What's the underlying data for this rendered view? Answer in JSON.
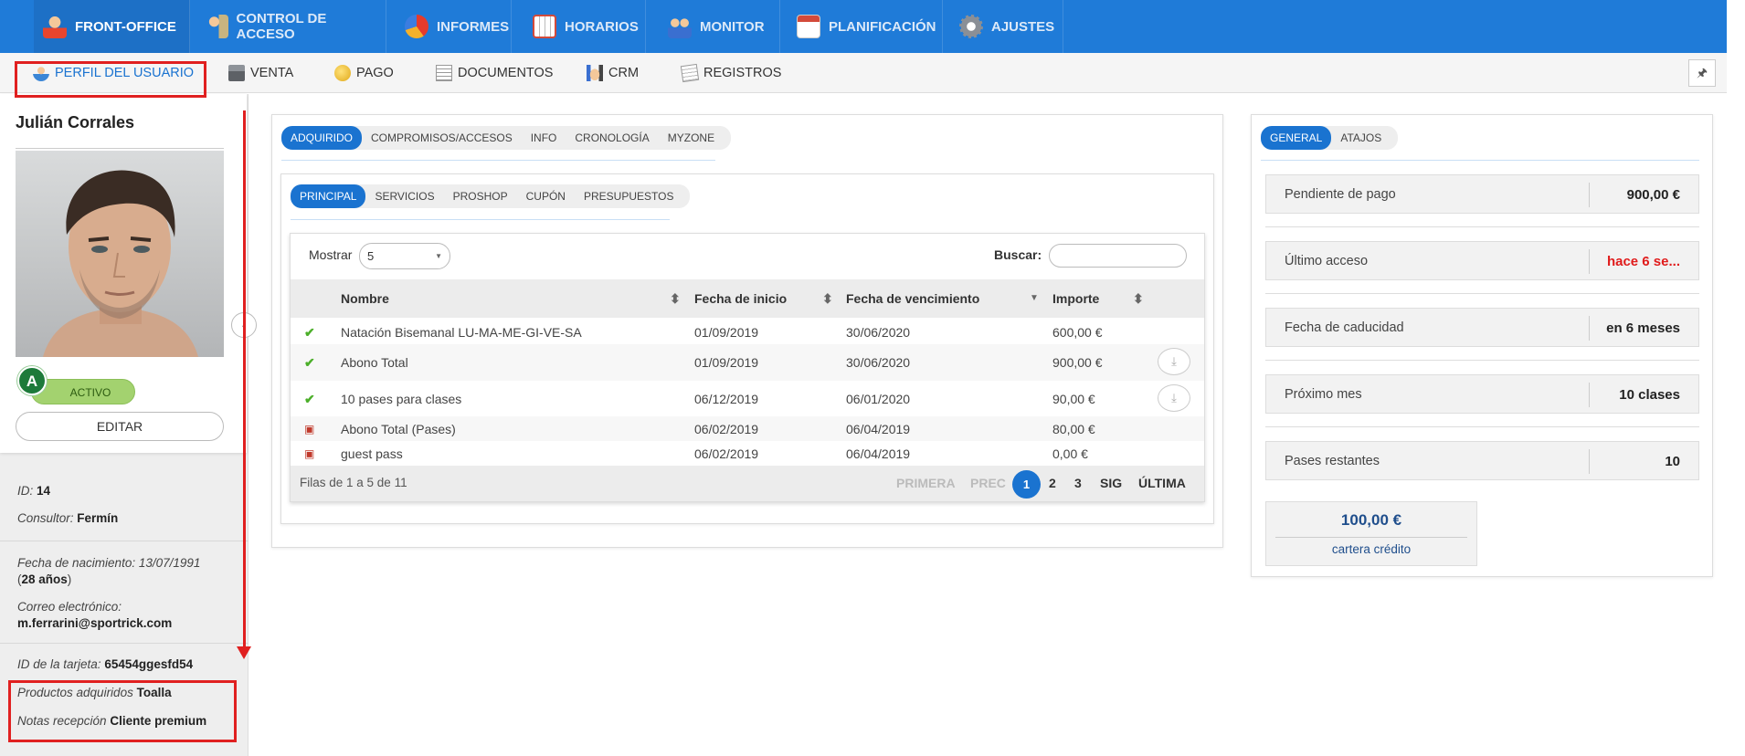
{
  "topnav": {
    "items": [
      {
        "label": "FRONT-OFFICE",
        "icon": "user-person-icon"
      },
      {
        "label": "CONTROL DE ACCESO",
        "icon": "access-control-icon"
      },
      {
        "label": "INFORMES",
        "icon": "pie-chart-icon"
      },
      {
        "label": "HORARIOS",
        "icon": "calendar-grid-icon"
      },
      {
        "label": "MONITOR",
        "icon": "group-users-icon"
      },
      {
        "label": "PLANIFICACIÓN",
        "icon": "calendar-icon"
      },
      {
        "label": "AJUSTES",
        "icon": "gear-icon"
      }
    ]
  },
  "subnav": {
    "items": [
      {
        "label": "PERFIL DEL USUARIO",
        "icon": "user-profile-icon"
      },
      {
        "label": "VENTA",
        "icon": "cash-register-icon"
      },
      {
        "label": "PAGO",
        "icon": "coin-icon"
      },
      {
        "label": "DOCUMENTOS",
        "icon": "documents-icon"
      },
      {
        "label": "CRM",
        "icon": "handshake-icon"
      },
      {
        "label": "REGISTROS",
        "icon": "notepad-icon"
      }
    ],
    "pin": "🖈"
  },
  "user": {
    "name": "Julián Corrales",
    "badge": "A",
    "status": "ACTIVO",
    "edit": "EDITAR",
    "id_label": "ID:",
    "id": "14",
    "consultor_label": "Consultor:",
    "consultor": "Fermín",
    "birth_label": "Fecha de nacimiento:",
    "birth": "13/07/1991",
    "age_open": "(",
    "age": "28 años",
    "age_close": ")",
    "email_label": "Correo electrónico:",
    "email": "m.ferrarini@sportrick.com",
    "card_label": "ID de la tarjeta:",
    "card": "65454ggesfd54",
    "products_label": "Productos adquiridos",
    "products": "Toalla",
    "notes_label": "Notas recepción",
    "notes": "Cliente premium"
  },
  "main_tabs": [
    "ADQUIRIDO",
    "COMPROMISOS/ACCESOS",
    "INFO",
    "CRONOLOGÍA",
    "MYZONE"
  ],
  "sub_tabs": [
    "PRINCIPAL",
    "SERVICIOS",
    "PROSHOP",
    "CUPÓN",
    "PRESUPUESTOS"
  ],
  "table": {
    "show_label": "Mostrar",
    "show_value": "5",
    "search_label": "Buscar:",
    "search_value": "",
    "columns": [
      "Nombre",
      "Fecha de inicio",
      "Fecha de vencimiento",
      "Importe"
    ],
    "rows": [
      {
        "status": "active",
        "icon": "✔",
        "name": "Natación Bisemanal LU-MA-ME-GI-VE-SA",
        "start": "01/09/2019",
        "end": "30/06/2020",
        "amount": "600,00 €",
        "download": false
      },
      {
        "status": "active-special",
        "icon": "✔",
        "name": "Abono Total",
        "start": "01/09/2019",
        "end": "30/06/2020",
        "amount": "900,00 €",
        "download": true
      },
      {
        "status": "active",
        "icon": "✔",
        "name": "10 pases para clases",
        "start": "06/12/2019",
        "end": "06/01/2020",
        "amount": "90,00 €",
        "download": true
      },
      {
        "status": "future",
        "icon": "▣",
        "name": "Abono Total (Pases)",
        "start": "06/02/2019",
        "end": "06/04/2019",
        "amount": "80,00 €",
        "download": false
      },
      {
        "status": "future",
        "icon": "▣",
        "name": "guest pass",
        "start": "06/02/2019",
        "end": "06/04/2019",
        "amount": "0,00 €",
        "download": false
      }
    ],
    "summary": "Filas de 1 a 5 de 11",
    "pager": {
      "first": "PRIMERA",
      "prev": "PREC",
      "pages": [
        "1",
        "2",
        "3"
      ],
      "next": "SIG",
      "last": "ÚLTIMA"
    }
  },
  "right_tabs": [
    "GENERAL",
    "ATAJOS"
  ],
  "stats": [
    {
      "label": "Pendiente de pago",
      "value": "900,00 €",
      "color": "#222222"
    },
    {
      "label": "Último acceso",
      "value": "hace 6 se...",
      "color": "#e01b1b"
    },
    {
      "label": "Fecha de caducidad",
      "value": "en 6 meses",
      "color": "#222222"
    },
    {
      "label": "Próximo mes",
      "value": "10 clases",
      "color": "#222222"
    },
    {
      "label": "Pases restantes",
      "value": "10",
      "color": "#222222"
    }
  ],
  "wallet": {
    "amount": "100,00 €",
    "label": "cartera crédito"
  },
  "colors": {
    "primary": "#1f7bd8",
    "active_tab": "#1a73d0",
    "status_green": "#a3d26f",
    "annotation_red": "#e02020"
  }
}
